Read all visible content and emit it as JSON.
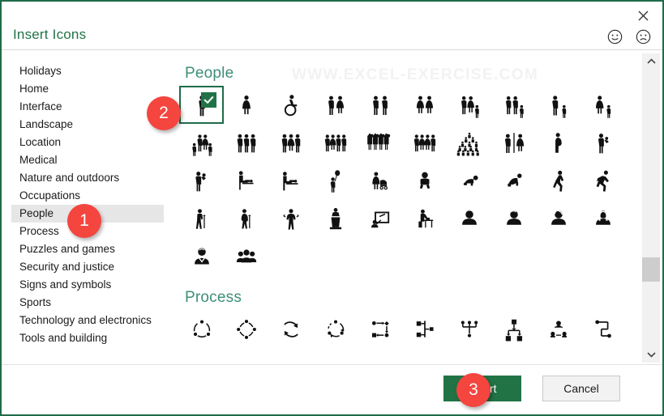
{
  "window": {
    "title": "Insert Icons",
    "close_icon": "close-x-icon",
    "feedback_happy_icon": "smiley-happy-icon",
    "feedback_sad_icon": "smiley-sad-icon"
  },
  "watermark": {
    "text": "WWW.EXCEL-EXERCISE.COM"
  },
  "sidebar": {
    "items": [
      {
        "label": "Holidays",
        "selected": false
      },
      {
        "label": "Home",
        "selected": false
      },
      {
        "label": "Interface",
        "selected": false
      },
      {
        "label": "Landscape",
        "selected": false
      },
      {
        "label": "Location",
        "selected": false
      },
      {
        "label": "Medical",
        "selected": false
      },
      {
        "label": "Nature and outdoors",
        "selected": false
      },
      {
        "label": "Occupations",
        "selected": false
      },
      {
        "label": "People",
        "selected": true
      },
      {
        "label": "Process",
        "selected": false
      },
      {
        "label": "Puzzles and games",
        "selected": false
      },
      {
        "label": "Security and justice",
        "selected": false
      },
      {
        "label": "Signs and symbols",
        "selected": false
      },
      {
        "label": "Sports",
        "selected": false
      },
      {
        "label": "Technology and electronics",
        "selected": false
      },
      {
        "label": "Tools and building",
        "selected": false
      }
    ]
  },
  "sections": [
    {
      "heading": "People",
      "rows": [
        [
          {
            "icon": "person-man-icon",
            "selected": true
          },
          {
            "icon": "person-woman-icon",
            "selected": false
          },
          {
            "icon": "person-wheelchair-icon",
            "selected": false
          },
          {
            "icon": "couple-man-woman-icon",
            "selected": false
          },
          {
            "icon": "couple-two-men-icon",
            "selected": false
          },
          {
            "icon": "couple-two-women-icon",
            "selected": false
          },
          {
            "icon": "family-parents-child-icon",
            "selected": false
          },
          {
            "icon": "family-two-men-child-icon",
            "selected": false
          },
          {
            "icon": "parent-man-child-icon",
            "selected": false
          },
          {
            "icon": "parent-woman-child-icon",
            "selected": false
          }
        ],
        [
          {
            "icon": "family-four-icon",
            "selected": false
          },
          {
            "icon": "group-three-men-icon",
            "selected": false
          },
          {
            "icon": "group-three-mixed-icon",
            "selected": false
          },
          {
            "icon": "group-four-people-icon",
            "selected": false
          },
          {
            "icon": "crowd-cheering-icon",
            "selected": false
          },
          {
            "icon": "group-four-mixed-icon",
            "selected": false
          },
          {
            "icon": "large-crowd-icon",
            "selected": false
          },
          {
            "icon": "restroom-sign-icon",
            "selected": false
          },
          {
            "icon": "pregnant-woman-icon",
            "selected": false
          },
          {
            "icon": "person-holding-baby-icon",
            "selected": false
          }
        ],
        [
          {
            "icon": "parent-carrying-baby-icon",
            "selected": false
          },
          {
            "icon": "changing-table-icon",
            "selected": false
          },
          {
            "icon": "caring-for-baby-icon",
            "selected": false
          },
          {
            "icon": "child-with-balloon-icon",
            "selected": false
          },
          {
            "icon": "woman-with-stroller-icon",
            "selected": false
          },
          {
            "icon": "baby-sitting-icon",
            "selected": false
          },
          {
            "icon": "baby-crawling-icon",
            "selected": false
          },
          {
            "icon": "toddler-crawling-icon",
            "selected": false
          },
          {
            "icon": "person-walking-icon",
            "selected": false
          },
          {
            "icon": "person-running-icon",
            "selected": false
          }
        ],
        [
          {
            "icon": "elderly-man-cane-icon",
            "selected": false
          },
          {
            "icon": "elderly-woman-cane-icon",
            "selected": false
          },
          {
            "icon": "person-shrugging-icon",
            "selected": false
          },
          {
            "icon": "speaker-podium-icon",
            "selected": false
          },
          {
            "icon": "presentation-board-icon",
            "selected": false
          },
          {
            "icon": "person-at-desk-icon",
            "selected": false
          },
          {
            "icon": "avatar-person-icon",
            "selected": false
          },
          {
            "icon": "avatar-short-hair-icon",
            "selected": false
          },
          {
            "icon": "avatar-woman-icon",
            "selected": false
          },
          {
            "icon": "avatar-long-hair-icon",
            "selected": false
          }
        ],
        [
          {
            "icon": "avatar-businessman-icon",
            "selected": false
          },
          {
            "icon": "group-of-three-avatars-icon",
            "selected": false
          }
        ]
      ]
    },
    {
      "heading": "Process",
      "rows": [
        [
          {
            "icon": "cycle-three-step-icon",
            "selected": false
          },
          {
            "icon": "cycle-four-step-icon",
            "selected": false
          },
          {
            "icon": "refresh-cycle-icon",
            "selected": false
          },
          {
            "icon": "circular-arrows-icon",
            "selected": false
          },
          {
            "icon": "process-flow-square-icon",
            "selected": false
          },
          {
            "icon": "branch-diagram-icon",
            "selected": false
          },
          {
            "icon": "tree-hierarchy-icon",
            "selected": false
          },
          {
            "icon": "org-chart-icon",
            "selected": false
          },
          {
            "icon": "people-network-icon",
            "selected": false
          },
          {
            "icon": "zigzag-path-icon",
            "selected": false
          }
        ]
      ]
    }
  ],
  "scrollbar": {
    "up_icon": "chevron-up-icon",
    "down_icon": "chevron-down-icon"
  },
  "footer": {
    "insert_label": "Insert",
    "cancel_label": "Cancel"
  },
  "callouts": [
    {
      "number": "1",
      "target": "sidebar-item-people"
    },
    {
      "number": "2",
      "target": "selected-icon-cell"
    },
    {
      "number": "3",
      "target": "insert-button"
    }
  ],
  "colors": {
    "accent_green": "#217346",
    "heading_green": "#3d8f79",
    "badge_red": "#f4453f",
    "selection_gray": "#e6e6e6"
  }
}
